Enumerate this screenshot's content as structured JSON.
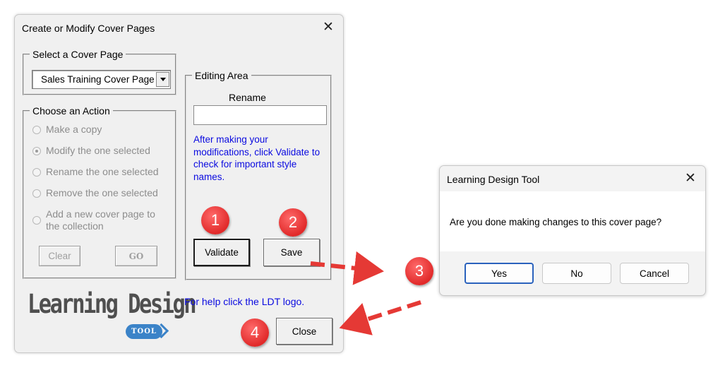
{
  "main_dialog": {
    "title": "Create or Modify Cover Pages",
    "close_glyph": "✕",
    "select_group": {
      "legend": "Select a Cover Page",
      "selected_value": "Sales Training Cover Page"
    },
    "action_group": {
      "legend": "Choose an Action",
      "options": [
        "Make a copy",
        "Modify the one selected",
        "Rename the one selected",
        "Remove the one selected",
        "Add a new cover page to the collection"
      ],
      "selected_index": 1,
      "clear_label": "Clear",
      "go_label": "GO"
    },
    "editing_group": {
      "legend": "Editing Area",
      "rename_label": "Rename",
      "rename_value": "",
      "info_text": "After making your modifications, click Validate to check for important style names.",
      "validate_label": "Validate",
      "save_label": "Save"
    },
    "logo": {
      "text": "Learning Design",
      "tag": "TOOL"
    },
    "help_text": "For help click the LDT logo.",
    "close_label": "Close"
  },
  "confirm_dialog": {
    "title": "Learning Design Tool",
    "close_glyph": "✕",
    "message": "Are you done making changes to this cover page?",
    "yes_label": "Yes",
    "no_label": "No",
    "cancel_label": "Cancel"
  },
  "callouts": {
    "step1": "1",
    "step2": "2",
    "step3": "3",
    "step4": "4",
    "color": "#e53935"
  },
  "colors": {
    "link_blue": "#0a0ae0",
    "logo_blue": "#3b83c8",
    "primary_button_border": "#2a62bd"
  }
}
